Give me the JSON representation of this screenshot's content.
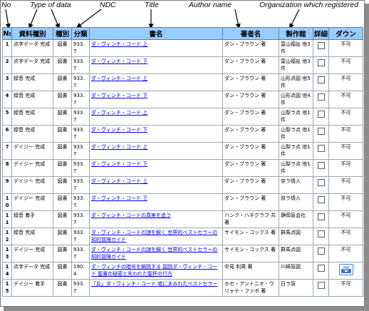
{
  "annotations": {
    "no": "No",
    "type_of_data": "Type of data",
    "ndc": "NDC",
    "title": "Title",
    "author_name": "Author name",
    "organization": "Organization which registered"
  },
  "table": {
    "headers": [
      "№",
      "資料種別",
      "種別",
      "分類",
      "書名",
      "著者名",
      "製作館",
      "詳細",
      "ダウン"
    ],
    "rows": [
      {
        "no": "1",
        "type": "点字データ 完成",
        "kind": "図書",
        "ndc": "933.7",
        "title": "ダ・ヴィンチ・コード 上",
        "author": "ダン・ブラウン 著",
        "org": "富山福祉 他3件",
        "dl": "不可",
        "has_button": false
      },
      {
        "no": "2",
        "type": "点字データ 完成",
        "kind": "図書",
        "ndc": "933.7",
        "title": "ダ・ヴィンチ・コード 下",
        "author": "ダン・ブラウン 著",
        "org": "富山福祉 他3件",
        "dl": "不可",
        "has_button": false
      },
      {
        "no": "3",
        "type": "録音 完成",
        "kind": "図書",
        "ndc": "933.7",
        "title": "ダ・ヴィンチ・コード 上",
        "author": "ダン・ブラウン 著",
        "org": "山形点図 他5件",
        "dl": "不可",
        "has_button": false
      },
      {
        "no": "4",
        "type": "録音 完成",
        "kind": "図書",
        "ndc": "933.7",
        "title": "ダ・ヴィンチ・コード 下",
        "author": "ダン・ブラウン 著",
        "org": "山形点図 他4件",
        "dl": "不可",
        "has_button": false
      },
      {
        "no": "5",
        "type": "録音 完成",
        "kind": "図書",
        "ndc": "933.7",
        "title": "ダ・ヴィンチ・コード 上",
        "author": "ダン・ブラウン 著",
        "org": "山梨ラ点 他1件",
        "dl": "不可",
        "has_button": false
      },
      {
        "no": "6",
        "type": "録音 完成",
        "kind": "図書",
        "ndc": "933.7",
        "title": "ダ・ヴィンチ・コード 下",
        "author": "ダン・ブラウン 著",
        "org": "山梨ラ点 他1件",
        "dl": "不可",
        "has_button": false
      },
      {
        "no": "7",
        "type": "デイジー 完成",
        "kind": "図書",
        "ndc": "933.7",
        "title": "ダ・ヴィンチ・コード 上",
        "author": "ダン・ブラウン 著",
        "org": "山梨ラ点 他1件",
        "dl": "不可",
        "has_button": false
      },
      {
        "no": "8",
        "type": "デイジー 完成",
        "kind": "図書",
        "ndc": "933.7",
        "title": "ダ・ヴィンチ・コード 下",
        "author": "ダン・ブラウン 著",
        "org": "山梨ラ点 他1件",
        "dl": "不可",
        "has_button": false
      },
      {
        "no": "9",
        "type": "デイジー 完成",
        "kind": "図書",
        "ndc": "933.7",
        "title": "ダ・ヴィンチ・コード 上",
        "author": "ダン・ブラウン 著",
        "org": "京ラ情入",
        "dl": "不可",
        "has_button": false
      },
      {
        "no": "10",
        "type": "デイジー 完成",
        "kind": "図書",
        "ndc": "933.7",
        "title": "ダ・ヴィンチ・コード 下",
        "author": "ダン・ブラウン 著",
        "org": "京ラ情入",
        "dl": "不可",
        "has_button": false
      },
      {
        "no": "11",
        "type": "録音 着手",
        "kind": "図書",
        "ndc": "933.7",
        "title": "ダ・ヴィンチ・コードの真実を追う",
        "author": "ハンク・ハネグラフ 共著",
        "org": "静岡盲会社",
        "dl": "不可",
        "has_button": false
      },
      {
        "no": "12",
        "type": "録音 完成",
        "kind": "図書",
        "ndc": "933.7",
        "title": "ダ・ヴィンチ・コードの謎を解く 世界的ベストセラーの知的冒険ガイド",
        "author": "サイモン・コックス 著",
        "org": "群馬点図",
        "dl": "不可",
        "has_button": false
      },
      {
        "no": "13",
        "type": "デイジー 完成",
        "kind": "図書",
        "ndc": "933.7",
        "title": "ダ・ヴィンチ・コードの謎を解く 世界的ベストセラーの知的冒険ガイド",
        "author": "サイモン・コックス 著",
        "org": "群馬点図",
        "dl": "不可",
        "has_button": false
      },
      {
        "no": "14",
        "type": "点字データ 完成",
        "kind": "図書",
        "ndc": "190.4",
        "title": "ダ・ヴィンチの暗号を解読する 図説ダ・ヴィンチ・コード 聖書の秘密と失われた聖杯の行方",
        "author": "中見 利男 著",
        "org": "川崎盲図",
        "dl": "",
        "has_button": true
      },
      {
        "no": "15",
        "type": "デイジー 着手",
        "kind": "図書",
        "ndc": "933.7",
        "title": "「反」ダ・ヴィンチ・コード 嘘にまみれたベストセラー",
        "author": "ホセ・アントニオ・ウリャテ・ファボ 著",
        "org": "日ラ盲",
        "dl": "不可",
        "has_button": false
      }
    ]
  },
  "colors": {
    "header_bg": "#99ccff",
    "link": "#0000ee"
  }
}
